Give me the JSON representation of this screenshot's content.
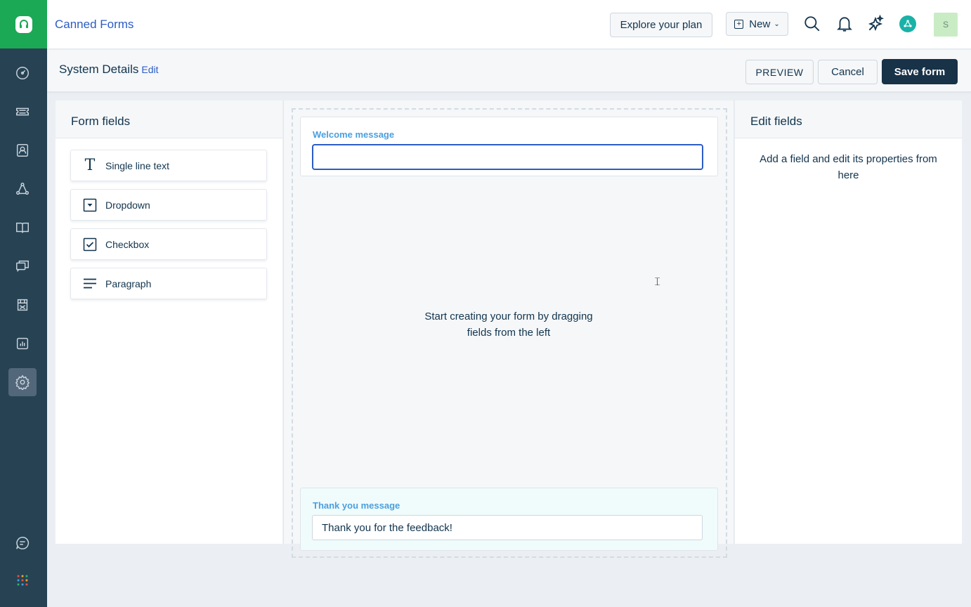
{
  "app": {
    "title": "Canned Forms"
  },
  "topbar": {
    "explore_label": "Explore your plan",
    "new_label": "New",
    "avatar_initial": "S"
  },
  "subheader": {
    "title": "System Details",
    "edit_label": "Edit",
    "preview_label": "PREVIEW",
    "cancel_label": "Cancel",
    "save_label": "Save form"
  },
  "form_fields": {
    "heading": "Form fields",
    "items": [
      {
        "label": "Single line text",
        "icon": "text-t-icon"
      },
      {
        "label": "Dropdown",
        "icon": "dropdown-icon"
      },
      {
        "label": "Checkbox",
        "icon": "checkbox-icon"
      },
      {
        "label": "Paragraph",
        "icon": "paragraph-icon"
      }
    ]
  },
  "canvas": {
    "welcome_label": "Welcome message",
    "welcome_value": "",
    "empty_hint": "Start creating your form by dragging fields from the left",
    "thanks_label": "Thank you message",
    "thanks_value": "Thank you for the feedback!"
  },
  "edit_fields": {
    "heading": "Edit fields",
    "hint": "Add a field and edit its properties from here"
  },
  "colors": {
    "sidebar": "#264253",
    "logo_green": "#1ba955",
    "primary_blue": "#2c5cc5",
    "save_button": "#183247"
  }
}
